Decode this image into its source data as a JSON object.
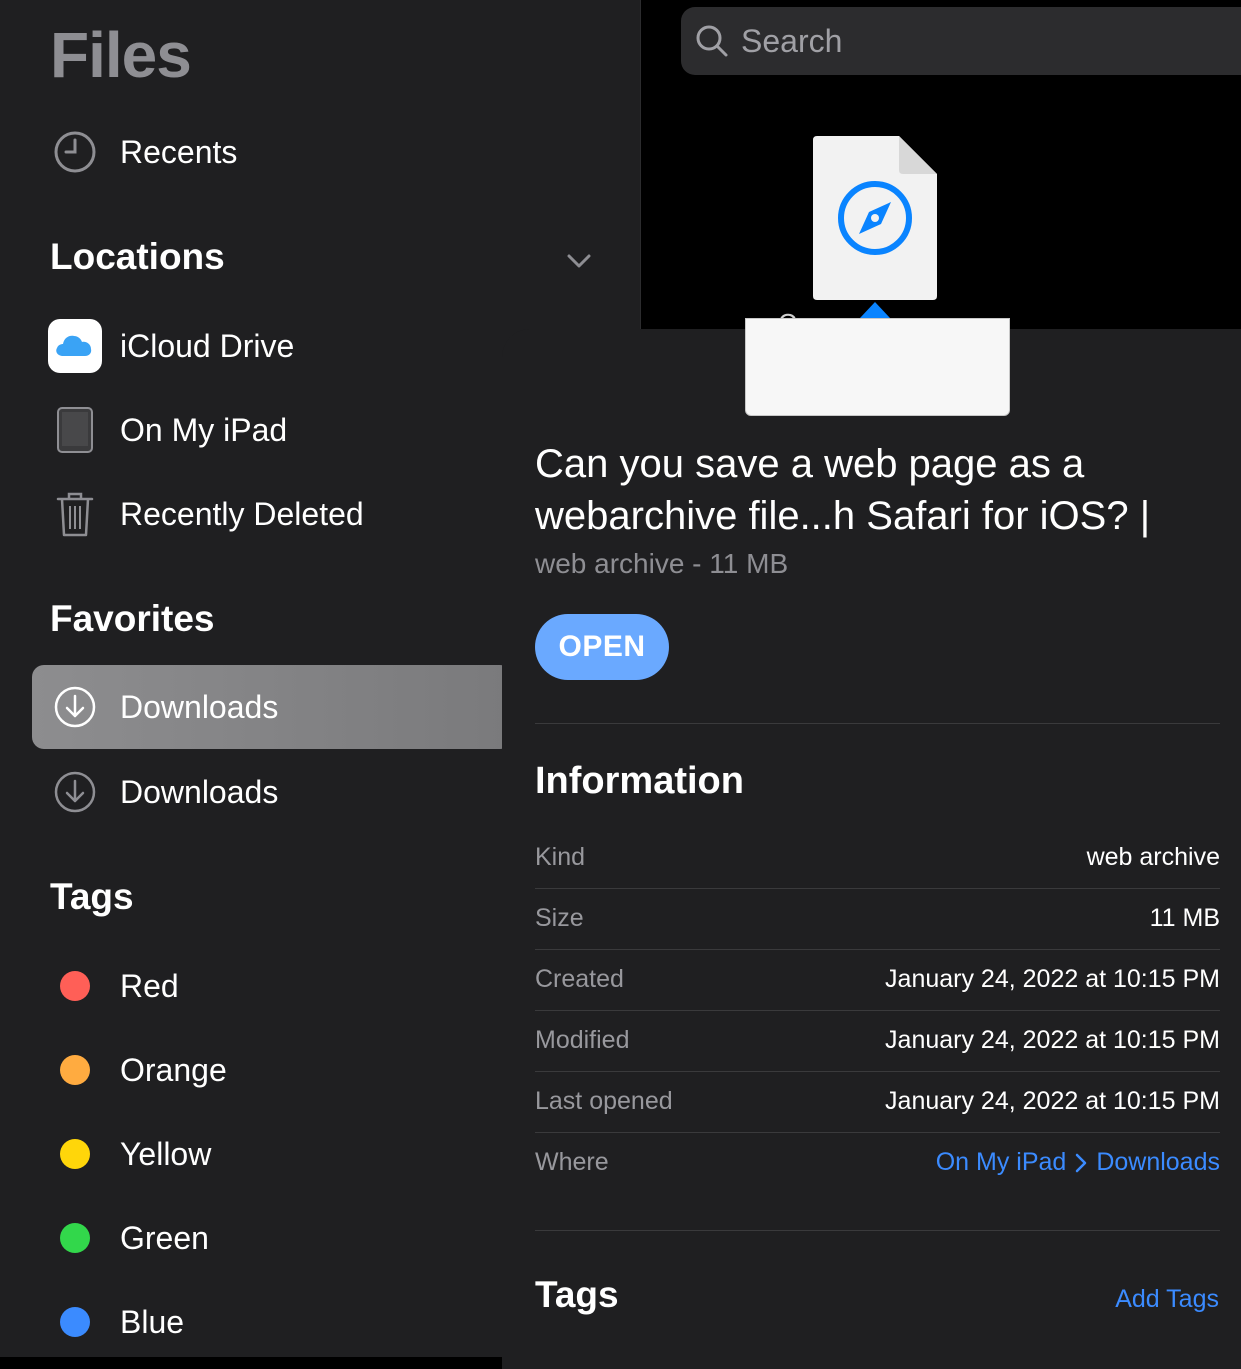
{
  "sidebar": {
    "title": "Files",
    "recents": "Recents",
    "locations_header": "Locations",
    "locations": [
      "iCloud Drive",
      "On My iPad",
      "Recently Deleted"
    ],
    "favorites_header": "Favorites",
    "favorites": [
      "Downloads",
      "Downloads"
    ],
    "tags_header": "Tags",
    "tags": [
      {
        "label": "Red",
        "color": "#ff5f57"
      },
      {
        "label": "Orange",
        "color": "#ffab40"
      },
      {
        "label": "Yellow",
        "color": "#ffd60a"
      },
      {
        "label": "Green",
        "color": "#32d74b"
      },
      {
        "label": "Blue",
        "color": "#3b8bff"
      }
    ]
  },
  "search": {
    "placeholder": "Search"
  },
  "file": {
    "caption": "Can you save a"
  },
  "info": {
    "title": "Can you save a web page as a webarchive file...h Safari for iOS? |",
    "subtitle": "web archive - 11 MB",
    "open_label": "OPEN",
    "section": "Information",
    "rows": [
      {
        "key": "Kind",
        "value": "web archive"
      },
      {
        "key": "Size",
        "value": "11 MB"
      },
      {
        "key": "Created",
        "value": "January 24, 2022 at 10:15 PM"
      },
      {
        "key": "Modified",
        "value": "January 24, 2022 at 10:15 PM"
      },
      {
        "key": "Last opened",
        "value": "January 24, 2022 at 10:15 PM"
      }
    ],
    "where_key": "Where",
    "where_path": [
      "On My iPad",
      "Downloads"
    ],
    "tags_header": "Tags",
    "add_tags": "Add Tags"
  },
  "colors": {
    "accent": "#3b8bff",
    "open_button": "#6aa9ff",
    "selected_row": "#8d8d8f"
  }
}
